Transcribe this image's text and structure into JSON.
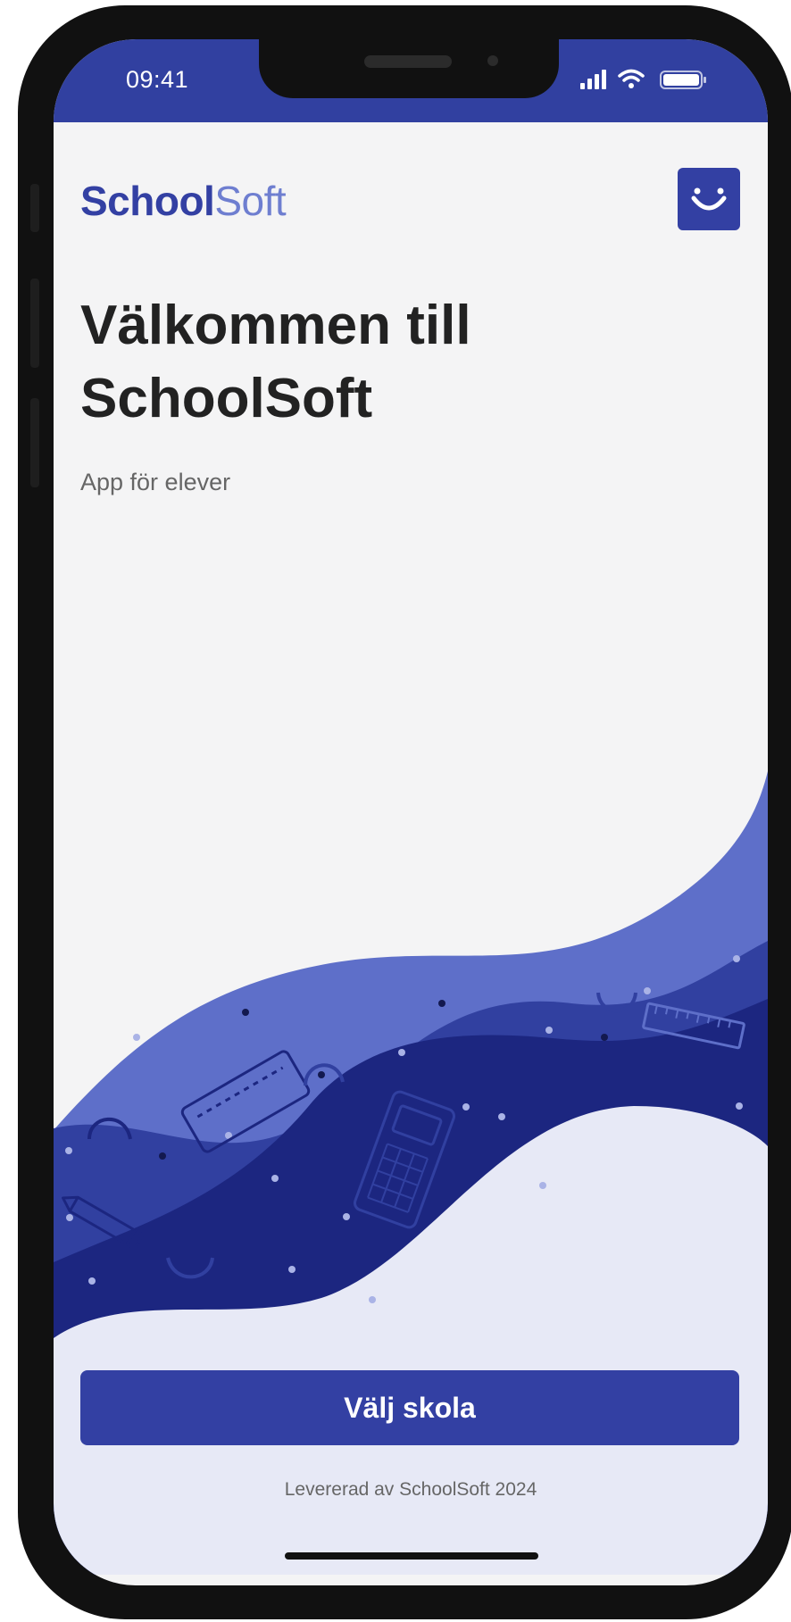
{
  "status_bar": {
    "time": "09:41",
    "icons": [
      "signal-icon",
      "wifi-icon",
      "battery-icon"
    ]
  },
  "logo": {
    "part1": "School",
    "part2": "Soft",
    "color_primary": "#3340a3",
    "color_secondary": "#6e7ed0"
  },
  "header": {
    "face_button_icon": "smiley-icon"
  },
  "welcome": {
    "line1": "Välkommen till",
    "line2": "SchoolSoft",
    "subtitle": "App för elever"
  },
  "illustration": {
    "icons": [
      "pencil-case-icon",
      "calculator-icon",
      "ruler-icon",
      "pencil-icon"
    ],
    "colors": [
      "#5e6fc9",
      "#3140a0",
      "#1c2680",
      "#e7e9f6"
    ]
  },
  "actions": {
    "choose_school": "Välj skola"
  },
  "footer": {
    "delivered_by": "Levererad av SchoolSoft 2024"
  }
}
